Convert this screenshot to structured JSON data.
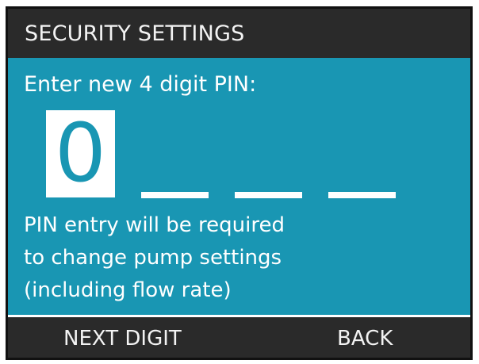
{
  "header": {
    "title": "SECURITY SETTINGS"
  },
  "pin_entry": {
    "prompt": "Enter new 4 digit PIN:",
    "current_digit": "0",
    "remaining_digits": 3
  },
  "info": {
    "lines": [
      "PIN entry will be required",
      "to change pump settings",
      "(including flow rate)"
    ]
  },
  "softkeys": {
    "left_label": "NEXT DIGIT",
    "right_label": "BACK"
  },
  "colors": {
    "screen_background": "#1996b3",
    "bar_background": "#2a2a2a",
    "text": "#ffffff"
  }
}
